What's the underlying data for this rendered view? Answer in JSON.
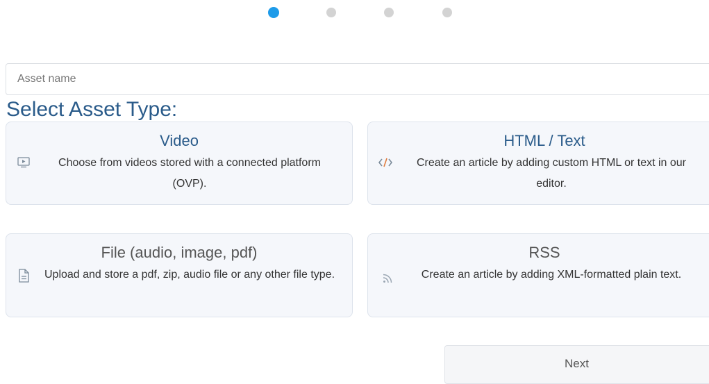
{
  "stepper": {
    "steps": 4,
    "active_step": 1,
    "active_color": "#1e9be9",
    "inactive_color": "#d3d3d3"
  },
  "asset_name": {
    "placeholder": "Asset name",
    "value": ""
  },
  "section_title": "Select Asset Type:",
  "asset_types": [
    {
      "title": "Video",
      "description": "Choose from videos stored with a connected platform (OVP).",
      "icon": "video-player-icon"
    },
    {
      "title": "HTML / Text",
      "description": "Create an article by adding custom HTML or text in our editor.",
      "icon": "code-icon"
    },
    {
      "title": "File (audio, image, pdf)",
      "description": "Upload and store a pdf, zip, audio file or any other file type.",
      "icon": "file-document-icon"
    },
    {
      "title": "RSS",
      "description": "Create an article by adding XML-formatted plain text.",
      "icon": "rss-icon"
    }
  ],
  "actions": {
    "next_label": "Next"
  },
  "colors": {
    "title_blue": "#2a5b8a",
    "card_bg": "#f5f7fb",
    "card_border": "#dde3ec"
  }
}
